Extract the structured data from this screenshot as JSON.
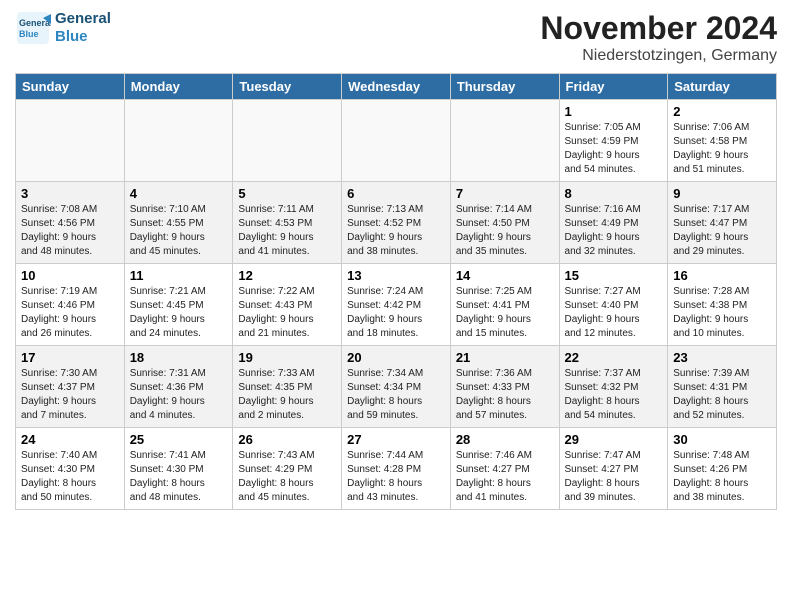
{
  "header": {
    "logo_line1": "General",
    "logo_line2": "Blue",
    "month_title": "November 2024",
    "location": "Niederstotzingen, Germany"
  },
  "weekdays": [
    "Sunday",
    "Monday",
    "Tuesday",
    "Wednesday",
    "Thursday",
    "Friday",
    "Saturday"
  ],
  "weeks": [
    [
      {
        "day": "",
        "info": ""
      },
      {
        "day": "",
        "info": ""
      },
      {
        "day": "",
        "info": ""
      },
      {
        "day": "",
        "info": ""
      },
      {
        "day": "",
        "info": ""
      },
      {
        "day": "1",
        "info": "Sunrise: 7:05 AM\nSunset: 4:59 PM\nDaylight: 9 hours\nand 54 minutes."
      },
      {
        "day": "2",
        "info": "Sunrise: 7:06 AM\nSunset: 4:58 PM\nDaylight: 9 hours\nand 51 minutes."
      }
    ],
    [
      {
        "day": "3",
        "info": "Sunrise: 7:08 AM\nSunset: 4:56 PM\nDaylight: 9 hours\nand 48 minutes."
      },
      {
        "day": "4",
        "info": "Sunrise: 7:10 AM\nSunset: 4:55 PM\nDaylight: 9 hours\nand 45 minutes."
      },
      {
        "day": "5",
        "info": "Sunrise: 7:11 AM\nSunset: 4:53 PM\nDaylight: 9 hours\nand 41 minutes."
      },
      {
        "day": "6",
        "info": "Sunrise: 7:13 AM\nSunset: 4:52 PM\nDaylight: 9 hours\nand 38 minutes."
      },
      {
        "day": "7",
        "info": "Sunrise: 7:14 AM\nSunset: 4:50 PM\nDaylight: 9 hours\nand 35 minutes."
      },
      {
        "day": "8",
        "info": "Sunrise: 7:16 AM\nSunset: 4:49 PM\nDaylight: 9 hours\nand 32 minutes."
      },
      {
        "day": "9",
        "info": "Sunrise: 7:17 AM\nSunset: 4:47 PM\nDaylight: 9 hours\nand 29 minutes."
      }
    ],
    [
      {
        "day": "10",
        "info": "Sunrise: 7:19 AM\nSunset: 4:46 PM\nDaylight: 9 hours\nand 26 minutes."
      },
      {
        "day": "11",
        "info": "Sunrise: 7:21 AM\nSunset: 4:45 PM\nDaylight: 9 hours\nand 24 minutes."
      },
      {
        "day": "12",
        "info": "Sunrise: 7:22 AM\nSunset: 4:43 PM\nDaylight: 9 hours\nand 21 minutes."
      },
      {
        "day": "13",
        "info": "Sunrise: 7:24 AM\nSunset: 4:42 PM\nDaylight: 9 hours\nand 18 minutes."
      },
      {
        "day": "14",
        "info": "Sunrise: 7:25 AM\nSunset: 4:41 PM\nDaylight: 9 hours\nand 15 minutes."
      },
      {
        "day": "15",
        "info": "Sunrise: 7:27 AM\nSunset: 4:40 PM\nDaylight: 9 hours\nand 12 minutes."
      },
      {
        "day": "16",
        "info": "Sunrise: 7:28 AM\nSunset: 4:38 PM\nDaylight: 9 hours\nand 10 minutes."
      }
    ],
    [
      {
        "day": "17",
        "info": "Sunrise: 7:30 AM\nSunset: 4:37 PM\nDaylight: 9 hours\nand 7 minutes."
      },
      {
        "day": "18",
        "info": "Sunrise: 7:31 AM\nSunset: 4:36 PM\nDaylight: 9 hours\nand 4 minutes."
      },
      {
        "day": "19",
        "info": "Sunrise: 7:33 AM\nSunset: 4:35 PM\nDaylight: 9 hours\nand 2 minutes."
      },
      {
        "day": "20",
        "info": "Sunrise: 7:34 AM\nSunset: 4:34 PM\nDaylight: 8 hours\nand 59 minutes."
      },
      {
        "day": "21",
        "info": "Sunrise: 7:36 AM\nSunset: 4:33 PM\nDaylight: 8 hours\nand 57 minutes."
      },
      {
        "day": "22",
        "info": "Sunrise: 7:37 AM\nSunset: 4:32 PM\nDaylight: 8 hours\nand 54 minutes."
      },
      {
        "day": "23",
        "info": "Sunrise: 7:39 AM\nSunset: 4:31 PM\nDaylight: 8 hours\nand 52 minutes."
      }
    ],
    [
      {
        "day": "24",
        "info": "Sunrise: 7:40 AM\nSunset: 4:30 PM\nDaylight: 8 hours\nand 50 minutes."
      },
      {
        "day": "25",
        "info": "Sunrise: 7:41 AM\nSunset: 4:30 PM\nDaylight: 8 hours\nand 48 minutes."
      },
      {
        "day": "26",
        "info": "Sunrise: 7:43 AM\nSunset: 4:29 PM\nDaylight: 8 hours\nand 45 minutes."
      },
      {
        "day": "27",
        "info": "Sunrise: 7:44 AM\nSunset: 4:28 PM\nDaylight: 8 hours\nand 43 minutes."
      },
      {
        "day": "28",
        "info": "Sunrise: 7:46 AM\nSunset: 4:27 PM\nDaylight: 8 hours\nand 41 minutes."
      },
      {
        "day": "29",
        "info": "Sunrise: 7:47 AM\nSunset: 4:27 PM\nDaylight: 8 hours\nand 39 minutes."
      },
      {
        "day": "30",
        "info": "Sunrise: 7:48 AM\nSunset: 4:26 PM\nDaylight: 8 hours\nand 38 minutes."
      }
    ]
  ]
}
